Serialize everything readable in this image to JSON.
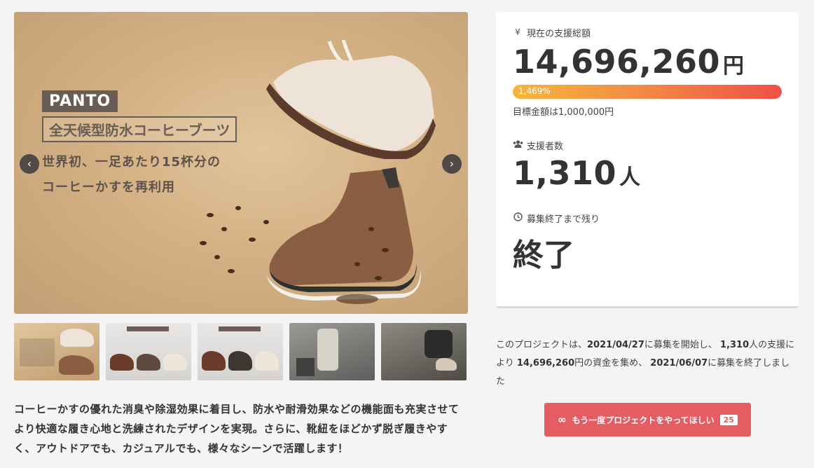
{
  "hero": {
    "brand": "PANTO",
    "product": "全天候型防水コーヒーブーツ",
    "copy_line1": "世界初、一足あたり15杯分の",
    "copy_line2": "コーヒーかすを再利用",
    "prev_icon": "chevron-left-icon",
    "next_icon": "chevron-right-icon"
  },
  "thumbnails": [
    {
      "label": "thumbnail-1"
    },
    {
      "label": "thumbnail-2"
    },
    {
      "label": "thumbnail-3"
    },
    {
      "label": "thumbnail-4"
    },
    {
      "label": "thumbnail-5"
    }
  ],
  "description": "コーヒーかすの優れた消臭や除湿効果に着目し、防水や耐滑効果などの機能面も充実させてより快適な履き心地と洗練されたデザインを実現。さらに、靴紐をほどかず脱ぎ履きやすく、アウトドアでも、カジュアルでも、様々なシーンで活躍します！",
  "stats": {
    "total_label": "現在の支援総額",
    "total_icon": "yen-icon",
    "total_amount": "14,696,260",
    "total_unit": "円",
    "progress_text": "1,469%",
    "progress_value": 14.69,
    "goal_text": "目標金額は1,000,000円",
    "supporters_label": "支援者数",
    "supporters_icon": "users-icon",
    "supporters_count": "1,310",
    "supporters_unit": "人",
    "remaining_label": "募集終了まで残り",
    "remaining_icon": "clock-icon",
    "remaining_value": "終了"
  },
  "summary": {
    "p1": "このプロジェクトは、",
    "start_date": "2021/04/27",
    "p2": "に募集を開始し、",
    "supporters": "1,310",
    "p3": "人の支援により",
    "amount": "14,696,260",
    "p4": "円の資金を集め、",
    "end_date": "2021/06/07",
    "p5": "に募集を終了しました"
  },
  "again_button": {
    "icon": "infinity-icon",
    "label": "もう一度プロジェクトをやってほしい",
    "count": "25"
  },
  "colors": {
    "accent": "#e35d63",
    "progress_start": "#f4b63c",
    "progress_end": "#ef5047"
  }
}
